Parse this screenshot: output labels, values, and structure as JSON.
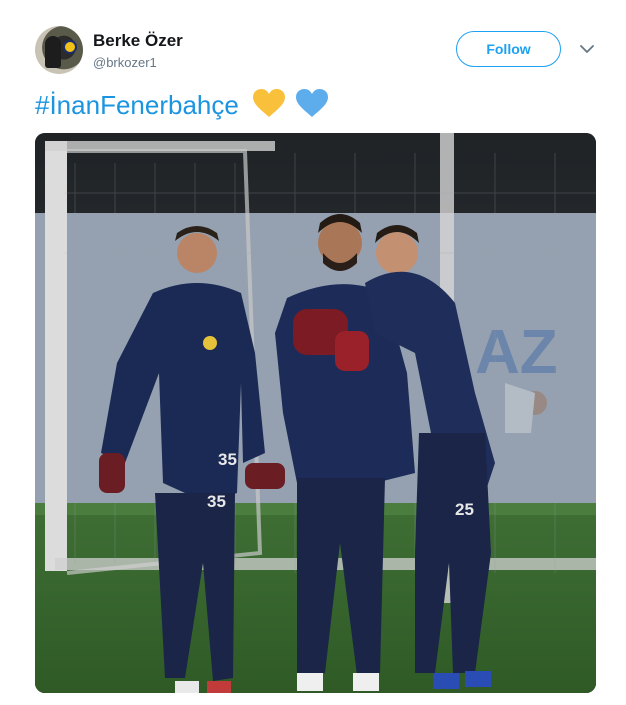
{
  "author": {
    "name": "Berke Özer",
    "handle": "@brkozer1"
  },
  "actions": {
    "follow_label": "Follow"
  },
  "tweet": {
    "hashtag": "#İnanFenerbahçe"
  },
  "photo": {
    "jersey_numbers": [
      "35",
      "35",
      "25"
    ],
    "banner_text": "AZ"
  },
  "colors": {
    "accent": "#1da1f2",
    "hashtag": "#1b95e0",
    "heart_yellow": "#f9c13b",
    "heart_blue": "#5dadec"
  },
  "icons": [
    "avatar",
    "chevron-down-icon",
    "yellow-heart-icon",
    "blue-heart-icon"
  ]
}
